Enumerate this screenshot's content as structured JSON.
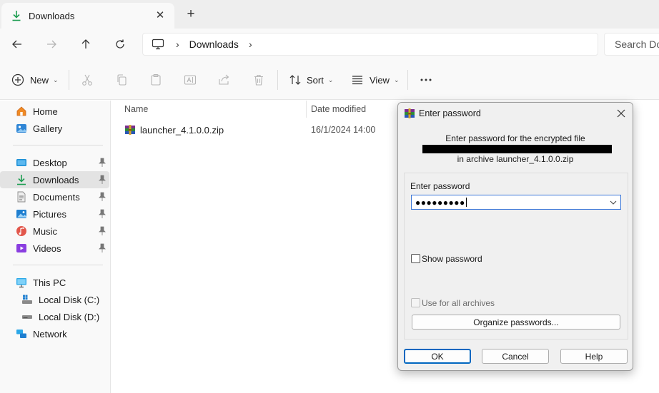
{
  "tab": {
    "title": "Downloads"
  },
  "address": {
    "crumb": "Downloads",
    "search_placeholder": "Search Do"
  },
  "toolbar": {
    "new_label": "New",
    "sort_label": "Sort",
    "view_label": "View"
  },
  "sidebar": {
    "items": [
      {
        "label": "Home"
      },
      {
        "label": "Gallery"
      },
      {
        "label": "Desktop"
      },
      {
        "label": "Downloads"
      },
      {
        "label": "Documents"
      },
      {
        "label": "Pictures"
      },
      {
        "label": "Music"
      },
      {
        "label": "Videos"
      },
      {
        "label": "This PC"
      },
      {
        "label": "Local Disk (C:)"
      },
      {
        "label": "Local Disk (D:)"
      },
      {
        "label": "Network"
      }
    ]
  },
  "filelist": {
    "columns": {
      "name": "Name",
      "date": "Date modified"
    },
    "files": [
      {
        "name": "launcher_4.1.0.0.zip",
        "date": "16/1/2024 14:00"
      }
    ]
  },
  "dialog": {
    "title": "Enter password",
    "line1": "Enter password for the encrypted file",
    "line3": "in archive launcher_4.1.0.0.zip",
    "field_label": "Enter password",
    "password_mask": "●●●●●●●●●",
    "show_password": "Show password",
    "use_all": "Use for all archives",
    "organize": "Organize passwords...",
    "ok": "OK",
    "cancel": "Cancel",
    "help": "Help"
  },
  "colors": {
    "accent": "#0067c0",
    "download_green": "#1e9e52",
    "selected_bg": "#e3e3e3"
  }
}
